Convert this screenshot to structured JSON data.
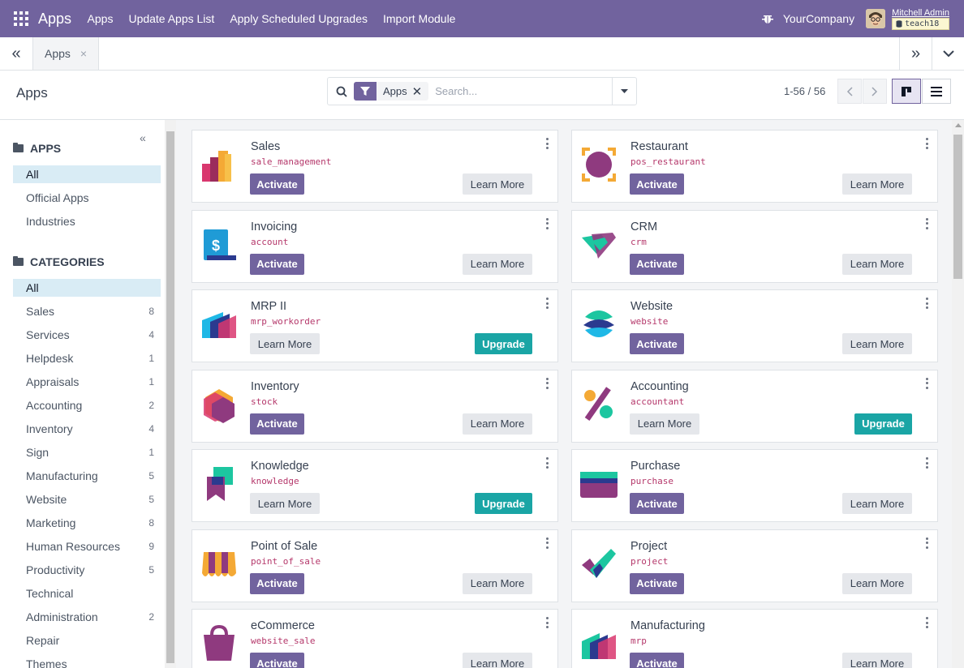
{
  "navbar": {
    "brand": "Apps",
    "menu": [
      "Apps",
      "Update Apps List",
      "Apply Scheduled Upgrades",
      "Import Module"
    ],
    "company": "YourCompany",
    "user": "Mitchell Admin",
    "database": "teach18",
    "brand_color": "#71639e"
  },
  "tabs": {
    "active_tab": "Apps",
    "close_glyph": "×"
  },
  "control_panel": {
    "breadcrumb": "Apps",
    "facet_label": "Apps",
    "search_placeholder": "Search...",
    "pager": "1-56 / 56"
  },
  "sidebar": {
    "apps_title": "APPS",
    "apps_items": [
      "All",
      "Official Apps",
      "Industries"
    ],
    "categories_title": "CATEGORIES",
    "categories": [
      {
        "label": "All",
        "count": ""
      },
      {
        "label": "Sales",
        "count": "8"
      },
      {
        "label": "Services",
        "count": "4"
      },
      {
        "label": "Helpdesk",
        "count": "1"
      },
      {
        "label": "Appraisals",
        "count": "1"
      },
      {
        "label": "Accounting",
        "count": "2"
      },
      {
        "label": "Inventory",
        "count": "4"
      },
      {
        "label": "Sign",
        "count": "1"
      },
      {
        "label": "Manufacturing",
        "count": "5"
      },
      {
        "label": "Website",
        "count": "5"
      },
      {
        "label": "Marketing",
        "count": "8"
      },
      {
        "label": "Human Resources",
        "count": "9"
      },
      {
        "label": "Productivity",
        "count": "5"
      },
      {
        "label": "Technical",
        "count": ""
      },
      {
        "label": "Administration",
        "count": "2"
      },
      {
        "label": "Repair",
        "count": ""
      },
      {
        "label": "Themes",
        "count": ""
      }
    ]
  },
  "buttons": {
    "activate": "Activate",
    "learn_more": "Learn More",
    "upgrade": "Upgrade"
  },
  "apps": [
    {
      "name": "Sales",
      "technical": "sale_management",
      "state": "activate",
      "icon": "sales-icon"
    },
    {
      "name": "Restaurant",
      "technical": "pos_restaurant",
      "state": "activate",
      "icon": "restaurant-icon"
    },
    {
      "name": "Invoicing",
      "technical": "account",
      "state": "activate",
      "icon": "invoicing-icon"
    },
    {
      "name": "CRM",
      "technical": "crm",
      "state": "activate",
      "icon": "crm-icon"
    },
    {
      "name": "MRP II",
      "technical": "mrp_workorder",
      "state": "upgrade",
      "icon": "mrp-icon"
    },
    {
      "name": "Website",
      "technical": "website",
      "state": "activate",
      "icon": "website-icon"
    },
    {
      "name": "Inventory",
      "technical": "stock",
      "state": "activate",
      "icon": "inventory-icon"
    },
    {
      "name": "Accounting",
      "technical": "accountant",
      "state": "upgrade",
      "icon": "accounting-icon"
    },
    {
      "name": "Knowledge",
      "technical": "knowledge",
      "state": "upgrade",
      "icon": "knowledge-icon"
    },
    {
      "name": "Purchase",
      "technical": "purchase",
      "state": "activate",
      "icon": "purchase-icon"
    },
    {
      "name": "Point of Sale",
      "technical": "point_of_sale",
      "state": "activate",
      "icon": "pos-icon"
    },
    {
      "name": "Project",
      "technical": "project",
      "state": "activate",
      "icon": "project-icon"
    },
    {
      "name": "eCommerce",
      "technical": "website_sale",
      "state": "activate",
      "icon": "ecommerce-icon"
    },
    {
      "name": "Manufacturing",
      "technical": "mrp",
      "state": "activate",
      "icon": "manufacturing-icon"
    }
  ]
}
